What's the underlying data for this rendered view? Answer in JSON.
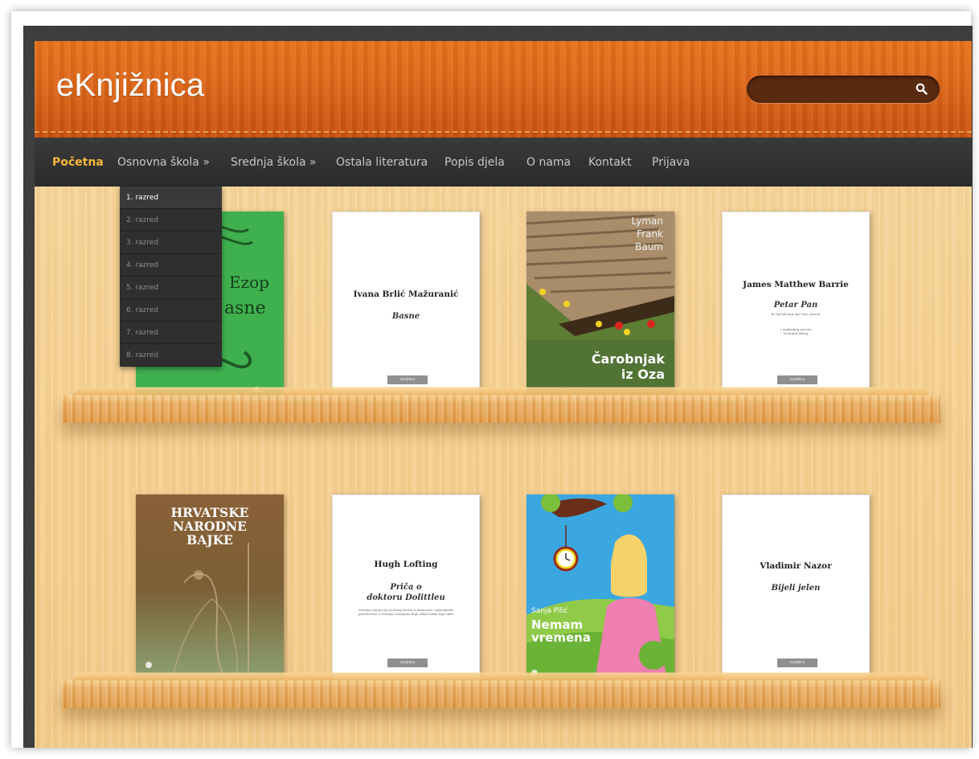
{
  "header": {
    "logo": "eKnjižnica",
    "search": {
      "value": "",
      "placeholder": "",
      "icon": "search-icon"
    },
    "accent": "#e8731a"
  },
  "nav": {
    "items": [
      {
        "label": "Početna",
        "active": true
      },
      {
        "label": "Osnovna škola »"
      },
      {
        "label": "Srednja škola »"
      },
      {
        "label": "Ostala literatura"
      },
      {
        "label": "Popis djela"
      },
      {
        "label": "O nama"
      },
      {
        "label": "Kontakt"
      },
      {
        "label": "Prijava"
      }
    ]
  },
  "dropdown": {
    "items": [
      "1. razred",
      "2. razred",
      "3. razred",
      "4. razred",
      "5. razred",
      "6. razred",
      "7. razred",
      "8. razred"
    ],
    "selected": "1. razred"
  },
  "books": [
    {
      "author": "Ezop",
      "title": "Basne",
      "visible_title": "asne",
      "cover": "green"
    },
    {
      "author": "Ivana Brlić Mažuranić",
      "title": "Basne",
      "cover": "white",
      "badge": "eLektira"
    },
    {
      "author": "Lyman Frank Baum",
      "author_lines": [
        "Lyman",
        "Frank",
        "Baum"
      ],
      "title_lines": [
        "Čarobnjak",
        "iz Oza"
      ],
      "cover": "illustrated"
    },
    {
      "author": "James Matthew Barrie",
      "title": "Petar Pan",
      "subtitle": "ili Dječak koji nije htio odrasti",
      "translator": "s engleskog preveo\nZvonimir Balog",
      "cover": "white",
      "badge": "eLektira"
    },
    {
      "title_lines": [
        "HRVATSKE",
        "NARODNE",
        "BAJKE"
      ],
      "cover": "brown"
    },
    {
      "author": "Hugh Lofting",
      "title_lines": [
        "Priča o",
        "doktoru Dolittleu"
      ],
      "subtitle": "Povijest njegovog osobitog života u domovini i zabavljenih pustolovina u stranim zemljama koje nikad nitko nije vidio",
      "cover": "white",
      "badge": "eLektira"
    },
    {
      "author": "Sanja Pilić",
      "title_lines": [
        "Nemam",
        "vremena"
      ],
      "cover": "illustrated"
    },
    {
      "author": "Vladimir Nazor",
      "title": "Bijeli jelen",
      "cover": "white",
      "badge": "eLektira"
    }
  ],
  "colors": {
    "nav_bg": "#2f2f2f",
    "nav_active": "#f5b83c",
    "shelf": "#e8a957",
    "wood": "#f5d394"
  }
}
